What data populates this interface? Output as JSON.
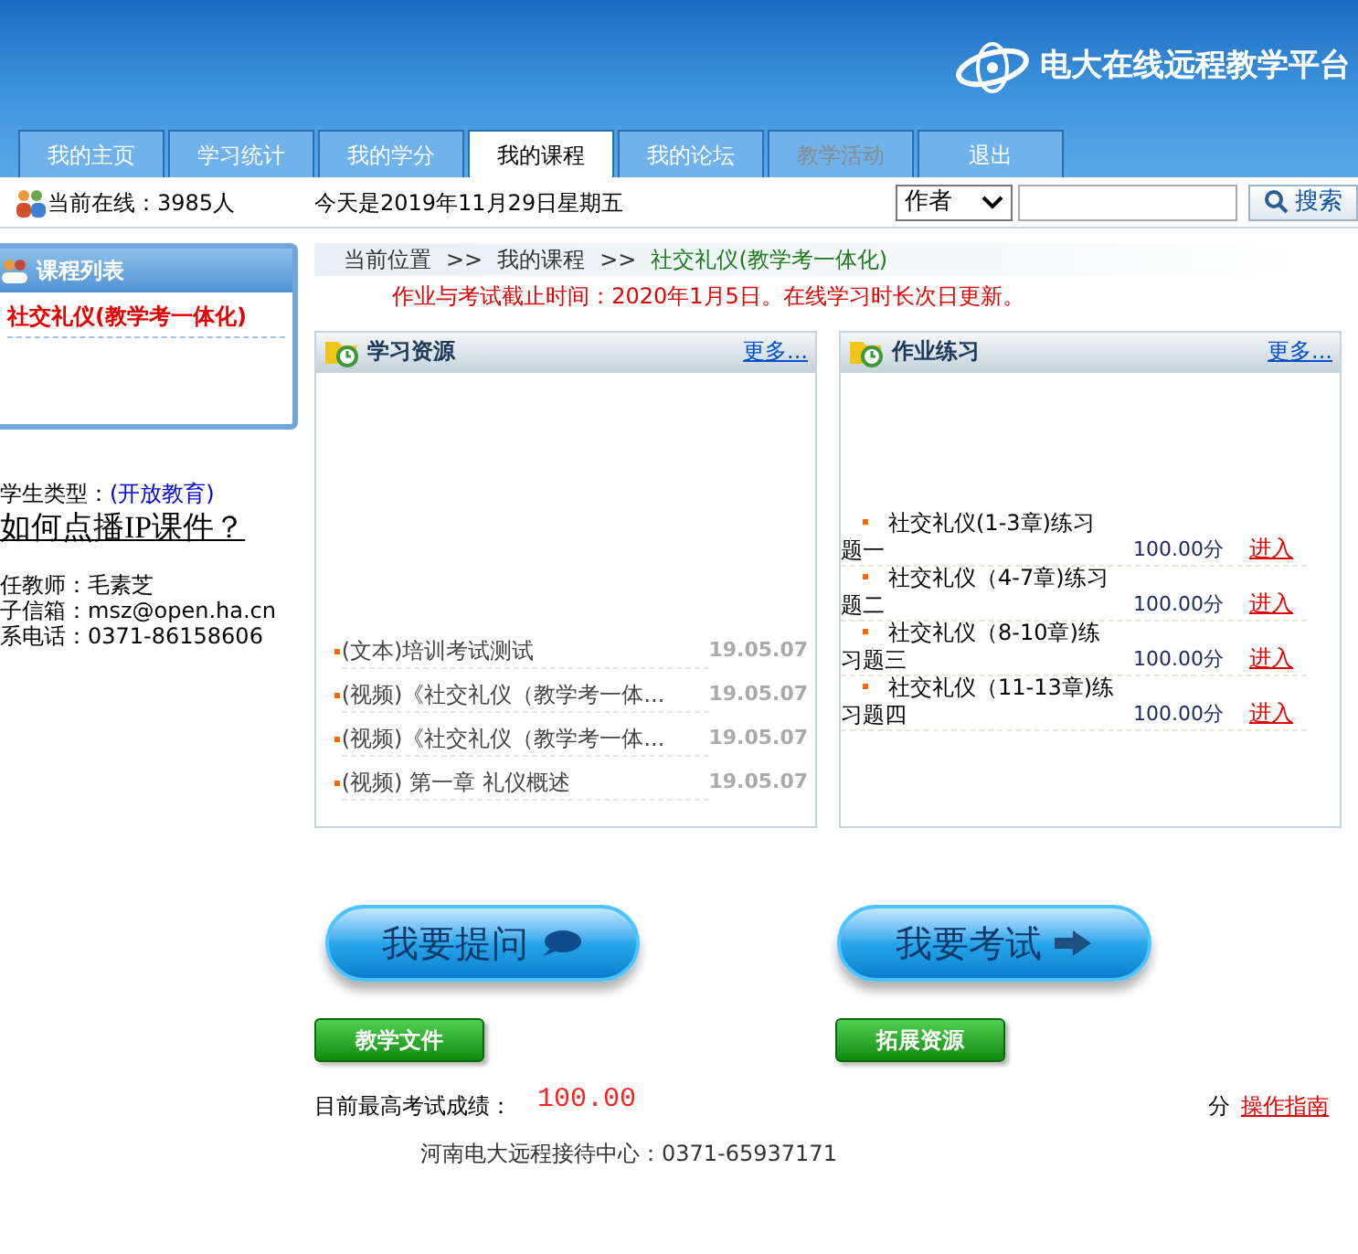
{
  "header": {
    "site_title": "电大在线远程教学平台"
  },
  "tabs": [
    {
      "label": "我的主页",
      "selected": false,
      "disabled": false
    },
    {
      "label": "学习统计",
      "selected": false,
      "disabled": false
    },
    {
      "label": "我的学分",
      "selected": false,
      "disabled": false
    },
    {
      "label": "我的课程",
      "selected": true,
      "disabled": false
    },
    {
      "label": "我的论坛",
      "selected": false,
      "disabled": false
    },
    {
      "label": "教学活动",
      "selected": false,
      "disabled": true
    },
    {
      "label": "退出",
      "selected": false,
      "disabled": false
    }
  ],
  "info_bar": {
    "online": "当前在线：3985人",
    "date": "今天是2019年11月29日星期五",
    "search_scope": "作者",
    "search_button": "搜索"
  },
  "sidebar": {
    "title": "课程列表",
    "courses": [
      {
        "label": "社交礼仪(教学考一体化)",
        "selected": true
      }
    ],
    "student_type_label": "学生类型：",
    "student_type": "(开放教育)",
    "help_link": "如何点播IP课件？",
    "contacts": [
      "任教师：毛素芝",
      "子信箱：msz@open.ha.cn",
      "系电话：0371-86158606"
    ]
  },
  "breadcrumb": [
    "当前位置",
    ">>",
    "我的课程",
    ">>",
    "社交礼仪(教学考一体化)"
  ],
  "notice": "作业与考试截止时间：2020年1月5日。在线学习时长次日更新。",
  "resources": {
    "title": "学习资源",
    "more": "更多...",
    "items": [
      {
        "title": "(文本)培训考试测试",
        "date": "19.05.07"
      },
      {
        "title": "(视频)《社交礼仪（教学考一体...",
        "date": "19.05.07"
      },
      {
        "title": "(视频)《社交礼仪（教学考一体...",
        "date": "19.05.07"
      },
      {
        "title": "(视频) 第一章 礼仪概述",
        "date": "19.05.07"
      }
    ]
  },
  "exercises": {
    "title": "作业练习",
    "more": "更多...",
    "items": [
      {
        "title": "社交礼仪(1-3章)练习题一",
        "score": "100.00分",
        "action": "进入"
      },
      {
        "title": "社交礼仪（4-7章)练习题二",
        "score": "100.00分",
        "action": "进入"
      },
      {
        "title": "社交礼仪（8-10章)练习题三",
        "score": "100.00分",
        "action": "进入"
      },
      {
        "title": "社交礼仪（11-13章)练习题四",
        "score": "100.00分",
        "action": "进入"
      }
    ]
  },
  "big_buttons": [
    {
      "label": "我要提问",
      "kind": "ask"
    },
    {
      "label": "我要考试",
      "kind": "exam"
    }
  ],
  "green_buttons": [
    "教学文件",
    "拓展资源"
  ],
  "score": {
    "label": "目前最高考试成绩：",
    "value": "100.00",
    "unit": "分",
    "guide": "操作指南"
  },
  "footer": "河南电大远程接待中心：0371-65937171"
}
